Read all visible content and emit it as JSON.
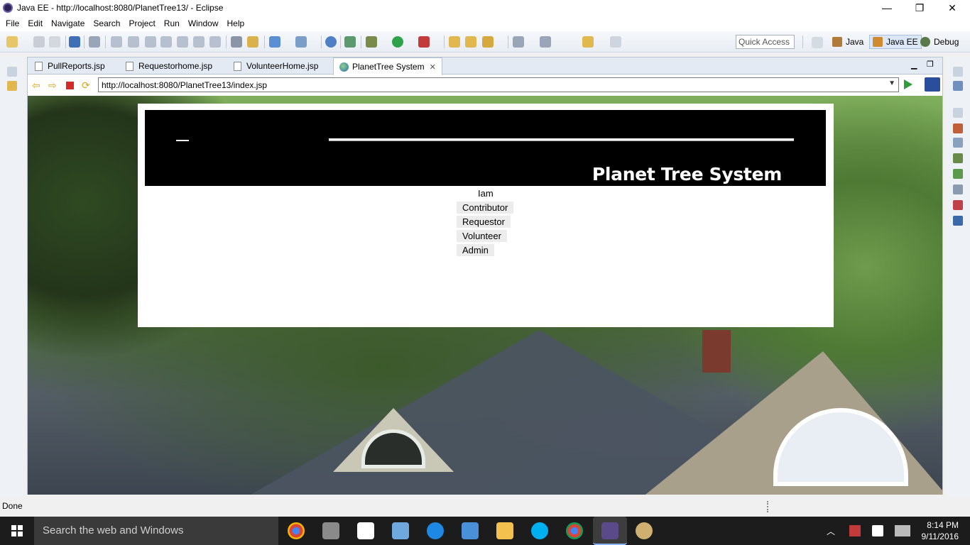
{
  "window": {
    "title": "Java EE - http://localhost:8080/PlanetTree13/ - Eclipse",
    "minimize": "—",
    "restore": "❐",
    "close": "✕"
  },
  "menubar": {
    "items": [
      "File",
      "Edit",
      "Navigate",
      "Search",
      "Project",
      "Run",
      "Window",
      "Help"
    ]
  },
  "toolbar": {
    "quick_access_placeholder": "Quick Access",
    "perspectives": [
      "Java",
      "Java EE",
      "Debug"
    ]
  },
  "editor": {
    "tabs": [
      {
        "label": "PullReports.jsp"
      },
      {
        "label": "Requestorhome.jsp"
      },
      {
        "label": "VolunteerHome.jsp"
      },
      {
        "label": "PlanetTree System",
        "close": "✕"
      }
    ],
    "url": "http://localhost:8080/PlanetTree13/index.jsp"
  },
  "page": {
    "brand": "Planet Tree System",
    "prompt": "Iam",
    "roles": [
      "Contributor",
      "Requestor",
      "Volunteer",
      "Admin"
    ]
  },
  "status": {
    "text": "Done"
  },
  "taskbar": {
    "search_placeholder": "Search the web and Windows",
    "time": "8:14 PM",
    "date": "9/11/2016",
    "tray_up": "︿"
  },
  "colors": {
    "banner_bg": "#000000",
    "brand_text": "#ffffff",
    "role_button_bg": "#ececec",
    "taskbar_bg": "#1c1c1c"
  },
  "icons": [
    "eclipse-icon",
    "back-icon",
    "forward-icon",
    "stop-icon",
    "refresh-icon",
    "go-icon",
    "globe-icon",
    "file-icon",
    "windows-start-icon",
    "chrome-icon",
    "edge-icon",
    "explorer-icon",
    "skype-icon",
    "store-icon"
  ]
}
